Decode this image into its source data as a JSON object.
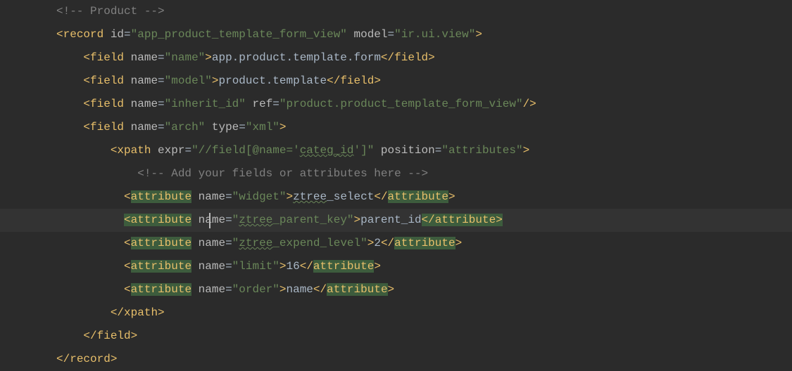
{
  "comment_product": "<!-- Product -->",
  "record_open": "record",
  "id_attr": "id",
  "id_val": "\"app_product_template_form_view\"",
  "model_attr": "model",
  "model_val": "\"ir.ui.view\"",
  "field_tag": "field",
  "name_attr": "name",
  "name_name_val": "\"name\"",
  "name_text": "app.product.template.form",
  "name_model_val": "\"model\"",
  "model_text": "product.template",
  "name_inherit_val": "\"inherit_id\"",
  "ref_attr": "ref",
  "ref_val": "\"product.product_template_form_view\"",
  "name_arch_val": "\"arch\"",
  "type_attr": "type",
  "type_val": "\"xml\"",
  "xpath_tag": "xpath",
  "expr_attr": "expr",
  "expr_pre": "\"//field[@name='",
  "expr_mid": "categ_id",
  "expr_post": "']\"",
  "position_attr": "position",
  "position_val": "\"attributes\"",
  "comment_add": "<!-- Add your fields or attributes here -->",
  "attribute_tag": "attribute",
  "widget_val": "\"widget\"",
  "ztree_pre": "ztree",
  "ztree_select_post": "_select",
  "pk_val_pre": "\"",
  "pk_val_post": "_parent_key\"",
  "ztree_text_pk": "ztree",
  "pk_text": "parent_id",
  "el_val_post": "_expend_level\"",
  "el_text": "2",
  "limit_val": "\"limit\"",
  "limit_text": "16",
  "order_val": "\"order\"",
  "order_text": "name",
  "lt": "<",
  "gt": ">",
  "slash": "/",
  "eq": "=",
  "sp": " "
}
